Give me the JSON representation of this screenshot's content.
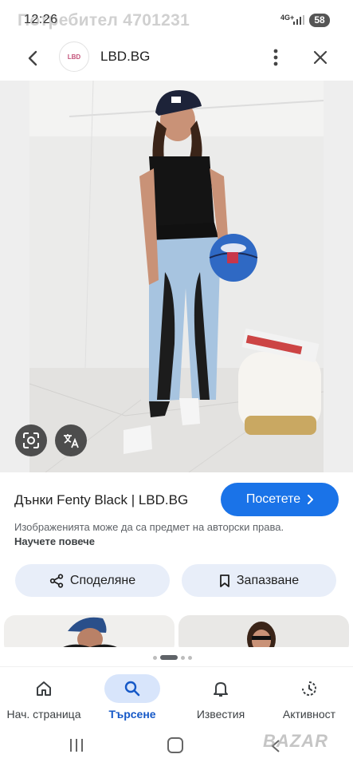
{
  "status_bar": {
    "time": "12:26",
    "watermark": "Потребител 4701231",
    "network": "4G+",
    "battery": "58"
  },
  "header": {
    "title": "LBD.BG",
    "logo_text": "LBD"
  },
  "result": {
    "title": "Дънки Fenty Black | LBD.BG",
    "visit_label": "Посетете",
    "copyright_text": "Изображенията може да са предмет на авторски права.",
    "learn_more": "Научете повече"
  },
  "actions": {
    "share_label": "Споделяне",
    "save_label": "Запазване"
  },
  "bottom_nav": {
    "items": [
      {
        "label": "Нач. страница",
        "icon": "home-icon",
        "active": false
      },
      {
        "label": "Търсене",
        "icon": "search-icon",
        "active": true
      },
      {
        "label": "Известия",
        "icon": "bell-icon",
        "active": false
      },
      {
        "label": "Активност",
        "icon": "activity-icon",
        "active": false
      }
    ]
  },
  "watermark": "BAZAR",
  "colors": {
    "accent": "#1a73e8",
    "chip_background": "#e8eef9",
    "nav_active": "#d8e5fb"
  }
}
